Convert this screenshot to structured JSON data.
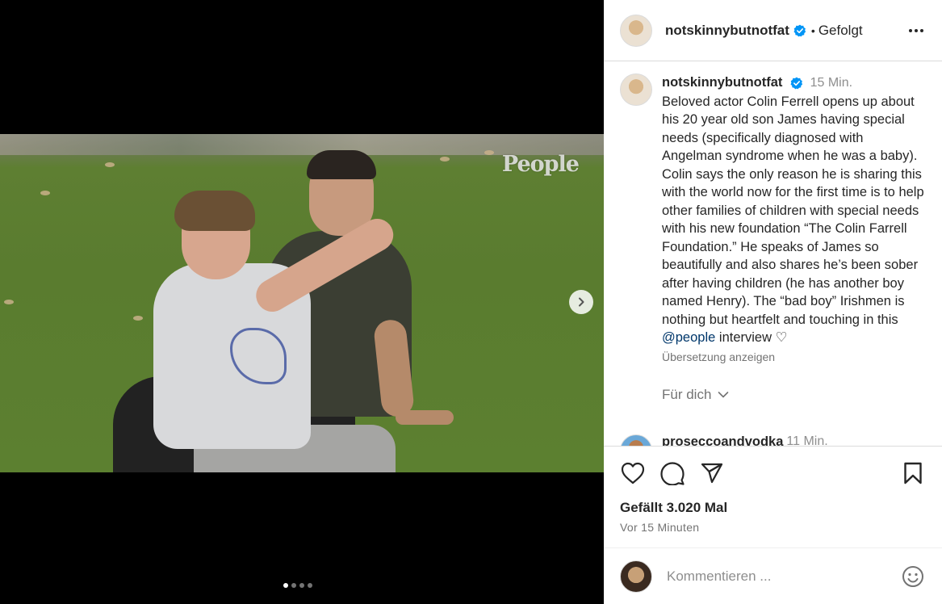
{
  "post": {
    "author": "notskinnybutnotfat",
    "follow_state": "Gefolgt",
    "separator": "•"
  },
  "media": {
    "watermark": "People",
    "carousel_count": 4,
    "active_index": 0
  },
  "caption": {
    "author": "notskinnybutnotfat",
    "time": "15 Min.",
    "text": "Beloved actor Colin Ferrell opens up about his 20 year old son James having special needs (specifically diagnosed with Angelman syndrome when he was a baby). Colin says the only reason he is sharing this with the world now for the first time is to help other families of children with special needs with his new foundation “The Colin Farrell Foundation.” He speaks of James so beautifully and also shares he’s been sober after having children (he has another boy named Henry). The “bad boy” Irishmen is nothing but heartfelt and touching in this",
    "mention": "@people",
    "text_end": " interview ♡",
    "translate": "Übersetzung anzeigen"
  },
  "for_you": "Für dich",
  "next_comment": {
    "author": "proseccoandvodka",
    "time": "11 Min."
  },
  "likes": "Gefällt 3.020 Mal",
  "post_time": "Vor 15 Minuten",
  "comment_box": {
    "placeholder": "Kommentieren ..."
  },
  "colors": {
    "verified": "#0095f6",
    "mention": "#00376b",
    "muted": "#737373"
  },
  "icons": [
    "verified-badge-icon",
    "more-options-icon",
    "chevron-right-icon",
    "heart-icon",
    "comment-icon",
    "share-icon",
    "bookmark-icon",
    "chevron-down-icon",
    "emoji-icon"
  ]
}
